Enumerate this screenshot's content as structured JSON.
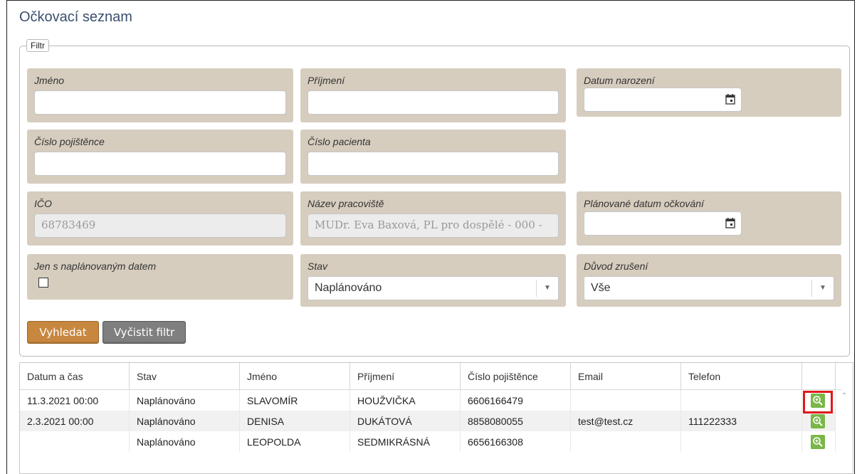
{
  "page": {
    "title": "Očkovací seznam"
  },
  "filter": {
    "legend": "Filtr",
    "fields": {
      "jmeno": {
        "label": "Jméno",
        "value": ""
      },
      "prijmeni": {
        "label": "Příjmení",
        "value": ""
      },
      "datum_narozeni": {
        "label": "Datum narození",
        "value": ""
      },
      "cislo_pojistence": {
        "label": "Číslo pojištěnce",
        "value": ""
      },
      "cislo_pacienta": {
        "label": "Číslo pacienta",
        "value": ""
      },
      "ico": {
        "label": "IČO",
        "value": "68783469"
      },
      "nazev_pracoviste": {
        "label": "Název pracoviště",
        "value": "MUDr. Eva Baxová, PL pro dospělé - 000 -"
      },
      "planovane_datum": {
        "label": "Plánované datum očkování",
        "value": ""
      },
      "jen_naplanovane": {
        "label": "Jen s naplánovaným datem",
        "checked": false
      },
      "stav": {
        "label": "Stav",
        "selected": "Naplánováno"
      },
      "duvod_zruseni": {
        "label": "Důvod zrušení",
        "selected": "Vše"
      }
    },
    "buttons": {
      "search": "Vyhledat",
      "clear": "Vyčistit filtr"
    }
  },
  "table": {
    "columns": [
      "Datum a čas",
      "Stav",
      "Jméno",
      "Příjmení",
      "Číslo pojištěnce",
      "Email",
      "Telefon"
    ],
    "rows": [
      {
        "datum": "11.3.2021 00:00",
        "stav": "Naplánováno",
        "jmeno": "SLAVOMÍR",
        "prijmeni": "HOUŽVIČKA",
        "cislo": "6606166479",
        "email": "",
        "telefon": ""
      },
      {
        "datum": "2.3.2021 00:00",
        "stav": "Naplánováno",
        "jmeno": "DENISA",
        "prijmeni": "DUKÁTOVÁ",
        "cislo": "8858080055",
        "email": "test@test.cz",
        "telefon": "111222333"
      },
      {
        "datum": "",
        "stav": "Naplánováno",
        "jmeno": "LEOPOLDA",
        "prijmeni": "SEDMIKRÁSNÁ",
        "cislo": "6656166308",
        "email": "",
        "telefon": ""
      }
    ]
  },
  "colors": {
    "accent_button": "#c8873f",
    "secondary_button": "#7f7f7f",
    "field_bg": "#d6cdbf",
    "detail_button": "#7ab648",
    "highlight": "#e0181b"
  }
}
